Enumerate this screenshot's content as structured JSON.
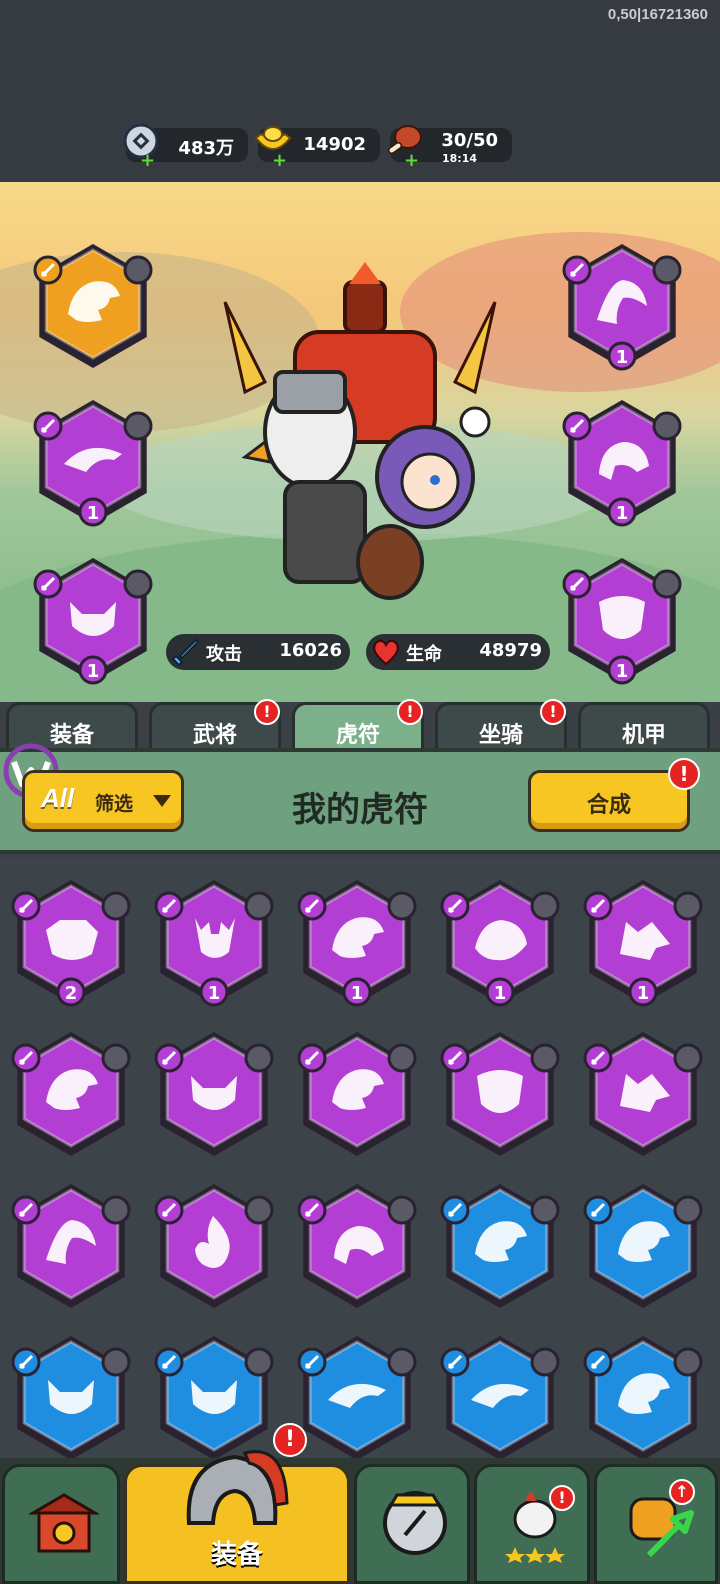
{
  "version_text": "0,50|16721360",
  "resources": [
    {
      "icon": "silver-coin-icon",
      "value": "483万"
    },
    {
      "icon": "gold-ingot-icon",
      "value": "14902"
    },
    {
      "icon": "meat-stamina-icon",
      "value": "30/50",
      "timer": "18:14"
    }
  ],
  "equipped_tallies": [
    {
      "color": "#f0a021",
      "creature": "dragon",
      "count": ""
    },
    {
      "color": "#b23ed3",
      "creature": "phoenix",
      "count": "1"
    },
    {
      "color": "#b23ed3",
      "creature": "whale",
      "count": "1"
    },
    {
      "color": "#b23ed3",
      "creature": "boar",
      "count": "1"
    },
    {
      "color": "#b23ed3",
      "creature": "fox",
      "count": "1"
    },
    {
      "color": "#b23ed3",
      "creature": "mask",
      "count": "1"
    }
  ],
  "stats": {
    "attack_label": "攻击",
    "attack_value": "16026",
    "hp_label": "生命",
    "hp_value": "48979"
  },
  "tabs": [
    {
      "label": "装备",
      "badge": ""
    },
    {
      "label": "武将",
      "badge": "!"
    },
    {
      "label": "虎符",
      "badge": "!",
      "active": true
    },
    {
      "label": "坐骑",
      "badge": "!"
    },
    {
      "label": "机甲",
      "badge": ""
    }
  ],
  "panel": {
    "filter_all": "All",
    "filter_label": "筛选",
    "title": "我的虎符",
    "merge_label": "合成",
    "merge_badge": "!"
  },
  "grid_items": [
    {
      "color": "purple",
      "creature": "tiger",
      "count": "2"
    },
    {
      "color": "purple",
      "creature": "deer",
      "count": "1"
    },
    {
      "color": "purple",
      "creature": "dragon",
      "count": "1"
    },
    {
      "color": "purple",
      "creature": "turtle",
      "count": "1"
    },
    {
      "color": "purple",
      "creature": "wolf",
      "count": "1"
    },
    {
      "color": "purple",
      "creature": "dragon",
      "count": ""
    },
    {
      "color": "purple",
      "creature": "fox",
      "count": ""
    },
    {
      "color": "purple",
      "creature": "dragon",
      "count": ""
    },
    {
      "color": "purple",
      "creature": "mask",
      "count": ""
    },
    {
      "color": "purple",
      "creature": "wolf",
      "count": ""
    },
    {
      "color": "purple",
      "creature": "phoenix",
      "count": ""
    },
    {
      "color": "purple",
      "creature": "flame",
      "count": ""
    },
    {
      "color": "purple",
      "creature": "boar",
      "count": ""
    },
    {
      "color": "blue",
      "creature": "dragon",
      "count": ""
    },
    {
      "color": "blue",
      "creature": "dragon",
      "count": ""
    },
    {
      "color": "blue",
      "creature": "fox",
      "count": ""
    },
    {
      "color": "blue",
      "creature": "fox",
      "count": ""
    },
    {
      "color": "blue",
      "creature": "whale",
      "count": ""
    },
    {
      "color": "blue",
      "creature": "whale",
      "count": ""
    },
    {
      "color": "blue",
      "creature": "dragon",
      "count": ""
    }
  ],
  "colors": {
    "purple": "#b23ed3",
    "blue": "#1f8de0",
    "gold": "#f0a021"
  },
  "bottom_nav": [
    {
      "icon": "gate-icon",
      "label": ""
    },
    {
      "icon": "helmet-icon",
      "label": "装备",
      "badge": "!",
      "active": true
    },
    {
      "icon": "shield-icon",
      "label": ""
    },
    {
      "icon": "chicken-stars-icon",
      "label": "",
      "badge": "!"
    },
    {
      "icon": "fist-upgrade-icon",
      "label": "",
      "badge": "↑"
    }
  ]
}
